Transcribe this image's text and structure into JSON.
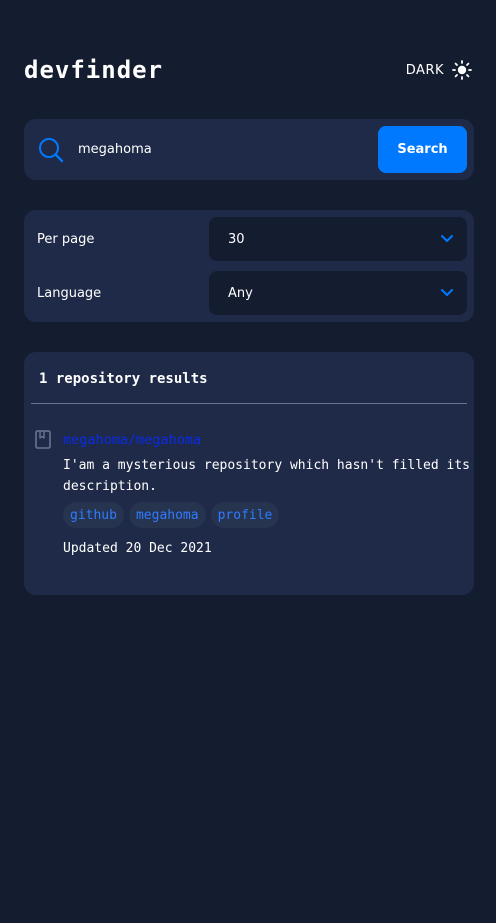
{
  "header": {
    "logo": "devfinder",
    "theme_label": "DARK",
    "theme_icon": "sun-icon"
  },
  "search": {
    "icon": "search-icon",
    "value": "megahoma",
    "button_label": "Search"
  },
  "filters": {
    "per_page": {
      "label": "Per page",
      "value": "30"
    },
    "language": {
      "label": "Language",
      "value": "Any"
    }
  },
  "results": {
    "title": "1 repository results",
    "items": [
      {
        "icon": "book-icon",
        "name": "megahoma/megahoma",
        "description": "I'am a mysterious repository which hasn't filled its description.",
        "topics": [
          "github",
          "megahoma",
          "profile"
        ],
        "updated": "Updated 20 Dec 2021"
      }
    ]
  },
  "colors": {
    "background": "#141d2f",
    "card": "#1e2a47",
    "accent": "#0079ff",
    "repo_link": "#0a2be8",
    "topic_text": "#2f7bff",
    "topic_bg": "#273450"
  }
}
